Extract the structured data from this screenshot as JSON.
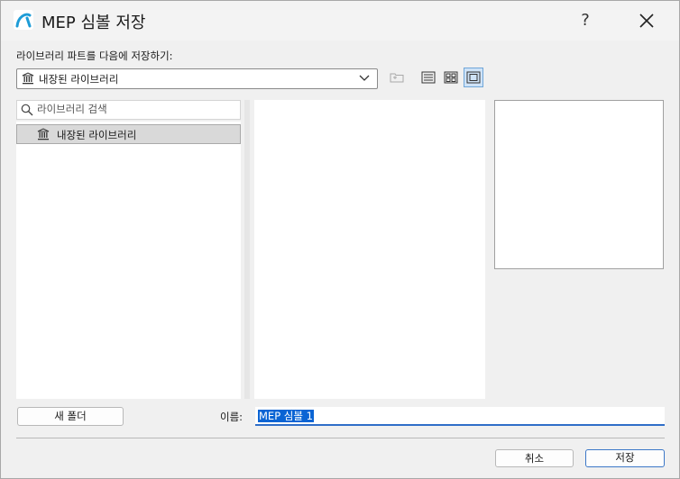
{
  "window": {
    "title": "MEP 심볼 저장",
    "help_label": "?",
    "app_icon": "archicad-logo-icon",
    "close_icon": "close-icon"
  },
  "location": {
    "label": "라이브러리 파트를 다음에 저장하기:",
    "selected": "내장된 라이브러리",
    "icon": "library-icon"
  },
  "toolbar": {
    "buttons": [
      {
        "name": "new-folder-icon",
        "active": false
      },
      {
        "name": "list-view-icon",
        "active": false
      },
      {
        "name": "grid-view-icon",
        "active": false
      },
      {
        "name": "preview-view-icon",
        "active": true
      }
    ]
  },
  "search": {
    "placeholder": "라이브러리 검색"
  },
  "tree": {
    "items": [
      {
        "label": "내장된 라이브러리",
        "icon": "library-icon",
        "selected": true
      }
    ]
  },
  "footer": {
    "new_folder_label": "새 폴더",
    "name_label": "이름:",
    "name_value": "MEP 심볼 1",
    "cancel_label": "취소",
    "save_label": "저장"
  },
  "colors": {
    "accent": "#0a64d4",
    "logo": "#1e9cd7",
    "active_toggle": "#cfe3f7"
  }
}
